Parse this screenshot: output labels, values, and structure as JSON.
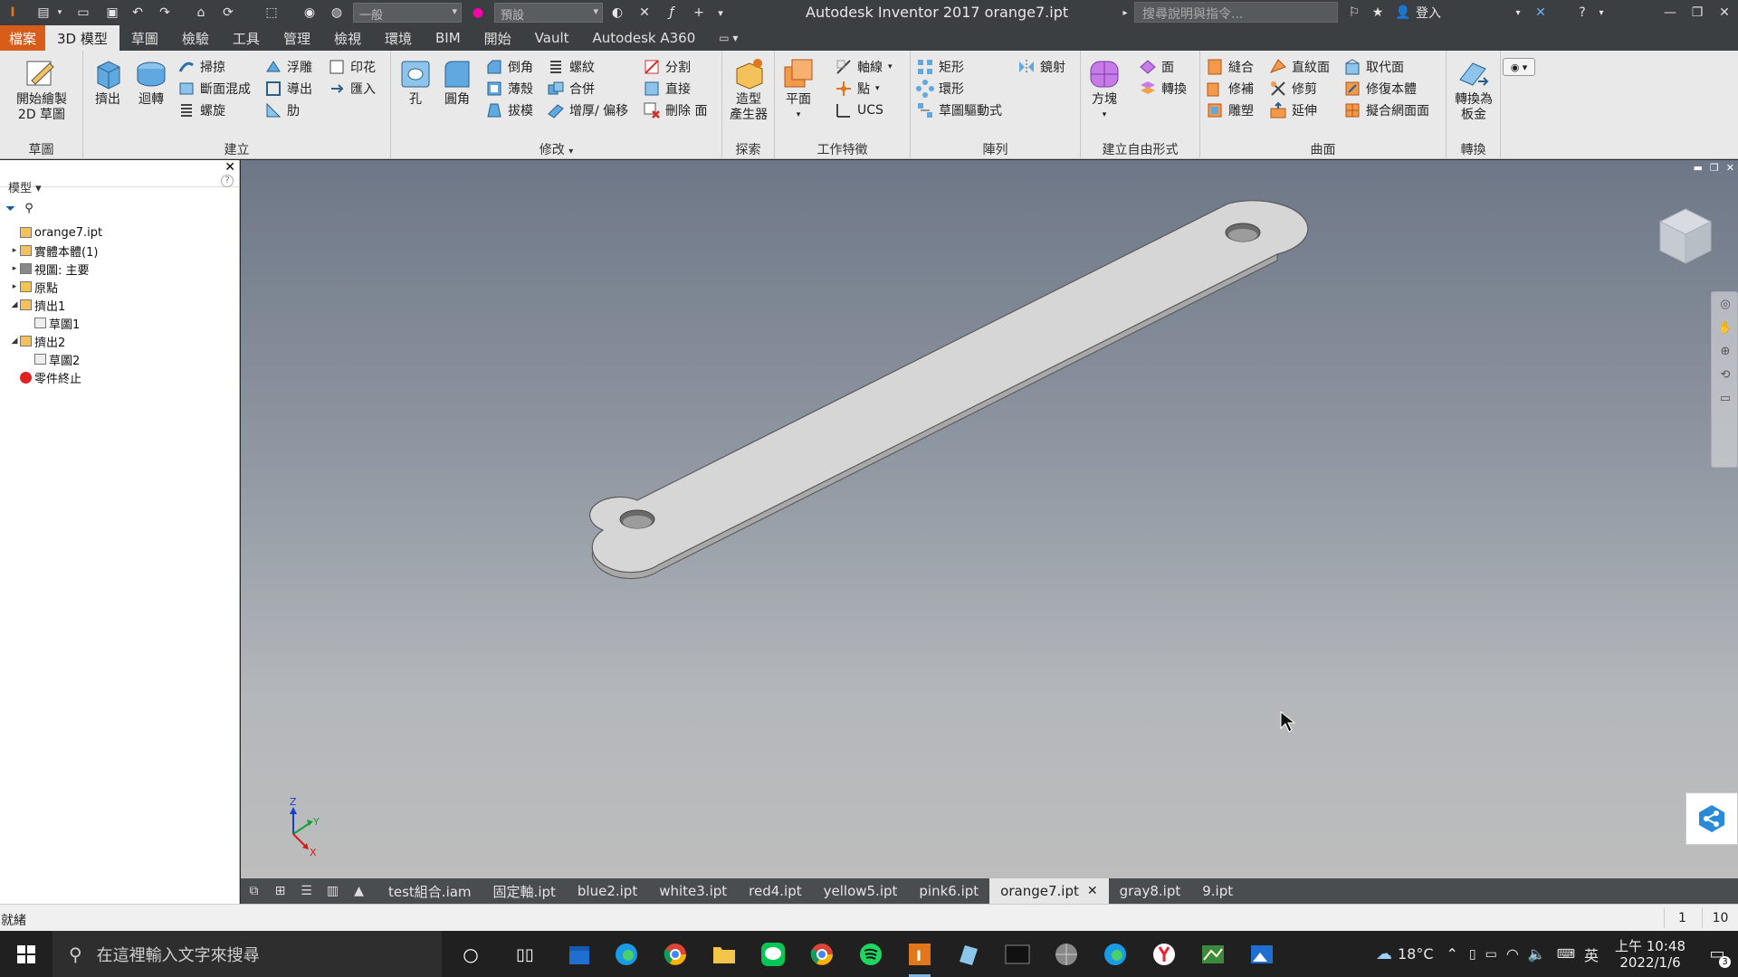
{
  "titlebar": {
    "app_title": "Autodesk Inventor 2017    orange7.ipt",
    "appearance_combo": "一般",
    "material_combo": "預設",
    "search_placeholder": "搜尋說明與指令...",
    "signin": "登入"
  },
  "ribbon_tabs": [
    "檔案",
    "3D 模型",
    "草圖",
    "檢驗",
    "工具",
    "管理",
    "檢視",
    "環境",
    "BIM",
    "開始",
    "Vault",
    "Autodesk A360"
  ],
  "ribbon_active_tab": "3D 模型",
  "ribbon": {
    "sketch": {
      "title": "草圖",
      "start_sketch": "開始繪製\n2D 草圖"
    },
    "create": {
      "title": "建立",
      "extrude": "擠出",
      "revolve": "迴轉",
      "sweep": "掃掠",
      "loft": "斷面混成",
      "coil": "螺旋",
      "emboss": "浮雕",
      "derive": "導出",
      "rib": "肋",
      "decal": "印花",
      "import": "匯入"
    },
    "modify": {
      "title": "修改",
      "hole": "孔",
      "fillet": "圓角",
      "chamfer": "倒角",
      "shell": "薄殼",
      "draft": "拔模",
      "thread": "螺紋",
      "combine": "合併",
      "thicken": "增厚/ 偏移",
      "split": "分割",
      "direct": "直接",
      "delete_face": "刪除 面"
    },
    "explore": {
      "title": "探索",
      "shape_generator": "造型\n產生器"
    },
    "work_features": {
      "title": "工作特徵",
      "plane": "平面",
      "axis": "軸線",
      "point": "點",
      "ucs": "UCS"
    },
    "pattern": {
      "title": "陣列",
      "rectangular": "矩形",
      "circular": "環形",
      "sketch_driven": "草圖驅動式",
      "mirror": "鏡射"
    },
    "freeform": {
      "title": "建立自由形式",
      "box": "方塊",
      "face": "面",
      "convert": "轉換"
    },
    "surface": {
      "title": "曲面",
      "stitch": "縫合",
      "patch": "修補",
      "sculpt": "雕塑",
      "ruled": "直紋面",
      "trim": "修剪",
      "extend": "延伸",
      "replace_face": "取代面",
      "repair_bodies": "修復本體",
      "fit_mesh": "擬合網面面"
    },
    "convert": {
      "title": "轉換",
      "to_sheet_metal": "轉換為\n板金"
    }
  },
  "browser": {
    "title": "模型",
    "tree": [
      {
        "label": "orange7.ipt",
        "level": 0,
        "expander": "",
        "icon": "part-icon"
      },
      {
        "label": "實體本體(1)",
        "level": 0,
        "expander": "▸",
        "icon": "solid-bodies-icon"
      },
      {
        "label": "視圖: 主要",
        "level": 0,
        "expander": "▸",
        "icon": "view-icon"
      },
      {
        "label": "原點",
        "level": 0,
        "expander": "▸",
        "icon": "folder-icon"
      },
      {
        "label": "擠出1",
        "level": 0,
        "expander": "◢",
        "icon": "extrude-icon"
      },
      {
        "label": "草圖1",
        "level": 1,
        "expander": "",
        "icon": "sketch-icon"
      },
      {
        "label": "擠出2",
        "level": 0,
        "expander": "◢",
        "icon": "extrude-icon"
      },
      {
        "label": "草圖2",
        "level": 1,
        "expander": "",
        "icon": "sketch-icon"
      },
      {
        "label": "零件終止",
        "level": 0,
        "expander": "",
        "icon": "end-of-part-icon"
      }
    ]
  },
  "viewport": {
    "triad": {
      "x": "X",
      "y": "Y",
      "z": "Z"
    }
  },
  "doc_tabs": [
    "test組合.iam",
    "固定軸.ipt",
    "blue2.ipt",
    "white3.ipt",
    "red4.ipt",
    "yellow5.ipt",
    "pink6.ipt",
    "orange7.ipt",
    "gray8.ipt",
    "9.ipt"
  ],
  "doc_active": "orange7.ipt",
  "status": {
    "text": "就緒",
    "count1": "1",
    "count2": "10"
  },
  "taskbar": {
    "search_placeholder": "在這裡輸入文字來搜尋",
    "weather": "18°C",
    "ime": "英",
    "time": "上午 10:48",
    "date": "2022/1/6",
    "notifications": "3"
  }
}
